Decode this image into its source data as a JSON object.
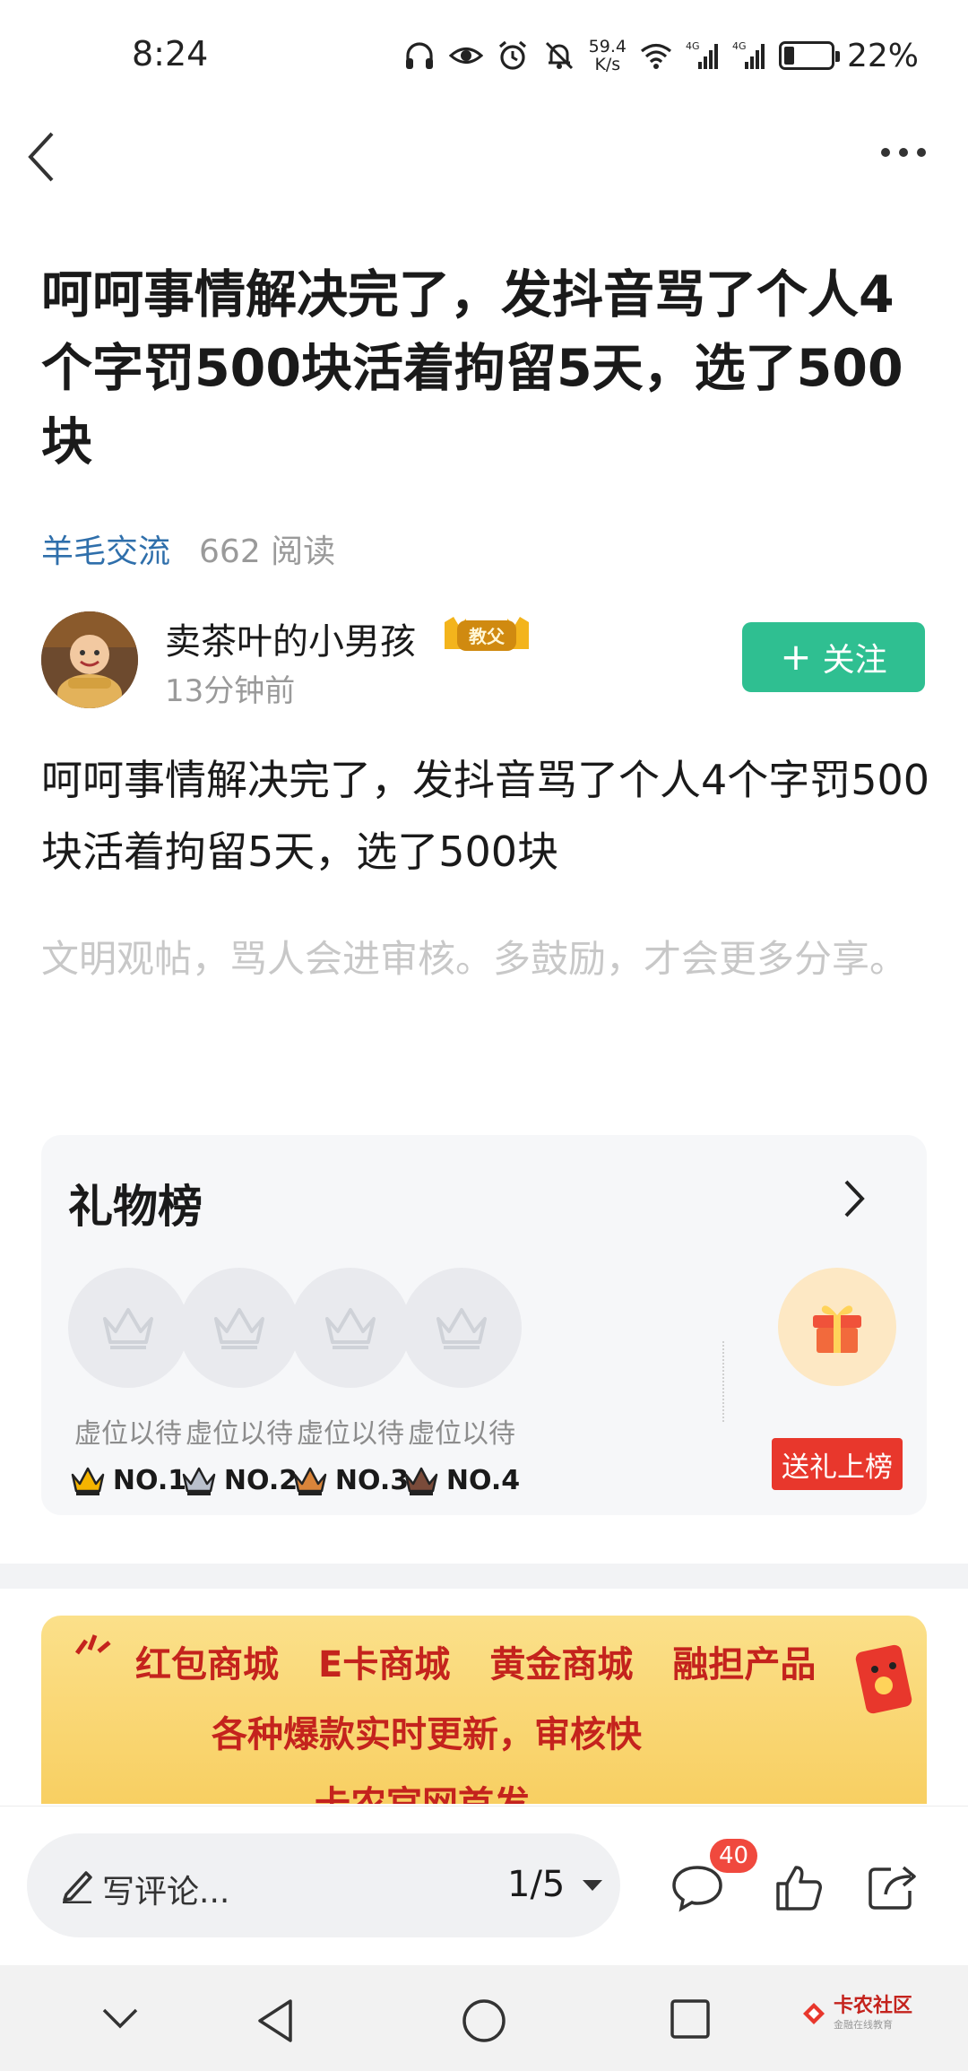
{
  "status_bar": {
    "time": "8:24",
    "net_speed_value": "59.4",
    "net_speed_unit": "K/s",
    "signal_1": "4G",
    "signal_2": "4G",
    "battery_percent": "22%",
    "battery_level": 0.22
  },
  "post": {
    "title": "呵呵事情解决完了，发抖音骂了个人4个字罚500块活着拘留5天，选了500块",
    "category": "羊毛交流",
    "read_count": "662 阅读",
    "author": {
      "name": "卖茶叶的小男孩",
      "badge": "教父",
      "time": "13分钟前"
    },
    "follow_label": "关注",
    "body": "呵呵事情解决完了，发抖音骂了个人4个字罚500块活着拘留5天，选了500块",
    "notice": "文明观帖，骂人会进审核。多鼓励，才会更多分享。"
  },
  "gift_board": {
    "title": "礼物榜",
    "slots": [
      {
        "label": "虚位以待",
        "rank": "NO.1",
        "crown_color": "#f5b400"
      },
      {
        "label": "虚位以待",
        "rank": "NO.2",
        "crown_color": "#b9c0cc"
      },
      {
        "label": "虚位以待",
        "rank": "NO.3",
        "crown_color": "#d9843a"
      },
      {
        "label": "虚位以待",
        "rank": "NO.4",
        "crown_color": "#7a4b3a"
      }
    ],
    "send_label": "送礼上榜"
  },
  "banner": {
    "items": [
      "红包商城",
      "E卡商城",
      "黄金商城",
      "融担产品"
    ],
    "subtitle": "各种爆款实时更新，审核快",
    "partial_line": "卡农官网首发"
  },
  "bottom_bar": {
    "comment_placeholder": "写评论...",
    "page_indicator": "1/5",
    "comment_count": "40"
  },
  "watermark": {
    "main": "卡农社区",
    "sub": "金融在线教育"
  },
  "colors": {
    "accent_green": "#2fbf91",
    "link_blue": "#2f6fab",
    "red": "#e8372c"
  }
}
